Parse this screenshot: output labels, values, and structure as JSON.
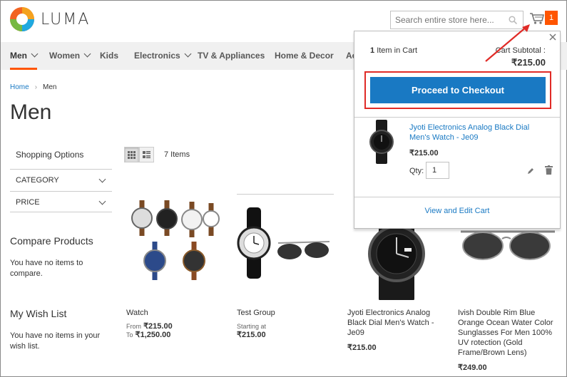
{
  "header": {
    "logo_text": "LUMA",
    "search_placeholder": "Search entire store here...",
    "cart_count": "1"
  },
  "nav": {
    "items": [
      {
        "label": "Men",
        "has_submenu": true
      },
      {
        "label": "Women",
        "has_submenu": true
      },
      {
        "label": "Kids",
        "has_submenu": false
      },
      {
        "label": "Electronics",
        "has_submenu": true
      },
      {
        "label": "TV & Appliances",
        "has_submenu": false
      },
      {
        "label": "Home & Decor",
        "has_submenu": false
      },
      {
        "label": "Ac",
        "has_submenu": false
      }
    ]
  },
  "breadcrumb": {
    "home": "Home",
    "current": "Men"
  },
  "page_title": "Men",
  "sidebar": {
    "shopping_options": "Shopping Options",
    "filters": [
      "CATEGORY",
      "PRICE"
    ],
    "compare_title": "Compare Products",
    "compare_text": "You have no items to compare.",
    "wishlist_title": "My Wish List",
    "wishlist_text": "You have no items in your wish list."
  },
  "toolbar": {
    "count": "7 Items",
    "active_mode": "grid"
  },
  "products": [
    {
      "name": "Watch",
      "from_label": "From",
      "from_price": "₹215.00",
      "to_label": "To",
      "to_price": "₹1,250.00"
    },
    {
      "name": "Test Group",
      "starting_label": "Starting at",
      "price": "₹215.00"
    },
    {
      "name": "Jyoti Electronics Analog Black Dial Men's Watch - Je09",
      "price": "₹215.00"
    },
    {
      "name": "Ivish Double Rim Blue Orange Ocean Water Color Sunglasses For Men 100% UV rotection (Gold Frame/Brown Lens)",
      "price": "₹249.00"
    }
  ],
  "minicart": {
    "items_count": "1",
    "items_label": "Item in Cart",
    "subtotal_label": "Cart Subtotal :",
    "subtotal": "₹215.00",
    "checkout_label": "Proceed to Checkout",
    "item": {
      "name": "Jyoti Electronics Analog Black Dial Men's Watch - Je09",
      "price": "₹215.00",
      "qty_label": "Qty:",
      "qty": "1"
    },
    "view_cart_label": "View and Edit Cart"
  },
  "colors": {
    "accent": "#ff5501",
    "primary_blue": "#1979c3",
    "highlight_red": "#e02b27"
  }
}
